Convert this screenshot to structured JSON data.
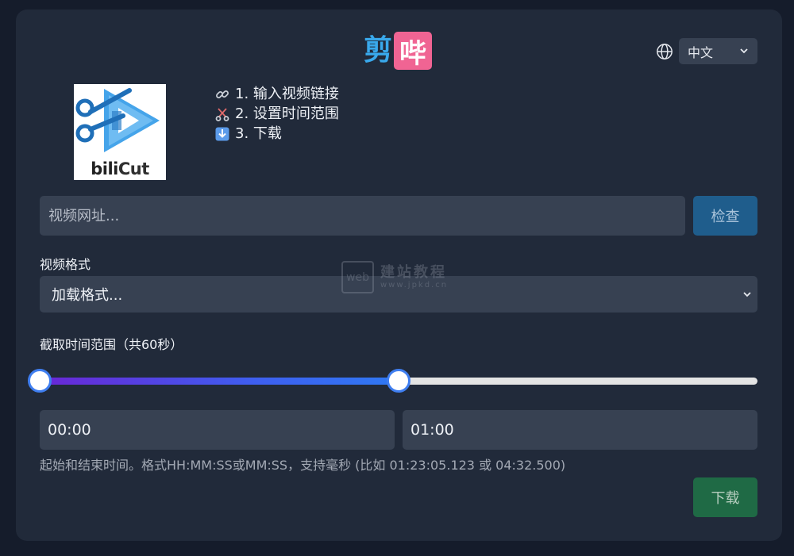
{
  "header": {
    "brand_part1": "剪",
    "brand_part2": "哔",
    "language": "中文"
  },
  "logo": {
    "word_bili": "bili",
    "word_cut": "Cut"
  },
  "steps": [
    {
      "icon": "link-icon",
      "text": "1. 输入视频链接"
    },
    {
      "icon": "scissors-icon",
      "text": "2. 设置时间范围"
    },
    {
      "icon": "download-arrow-icon",
      "text": "3. 下载"
    }
  ],
  "url": {
    "placeholder": "视频网址...",
    "check_label": "检查"
  },
  "format": {
    "label": "视频格式",
    "selected": "加载格式..."
  },
  "range": {
    "label": "截取时间范围（共60秒）",
    "start_fraction": 0.0,
    "end_fraction": 0.5,
    "start_value": "00:00",
    "end_value": "01:00",
    "hint": "起始和结束时间。格式HH:MM:SS或MM:SS，支持毫秒 (比如 01:23:05.123 或 04:32.500)"
  },
  "download_label": "下载",
  "watermark": {
    "box": "web",
    "cn": "建站教程",
    "en": "www.jpkd.cn"
  },
  "colors": {
    "background": "#151c2b",
    "card": "#212a3a",
    "field": "#374152",
    "brand_blue": "#39a9ec",
    "brand_pink": "#f06493",
    "check_button": "#1f5d8c",
    "download_button": "#1f6a45",
    "slider_start": "#6a26d6",
    "slider_end": "#2f79f3"
  }
}
